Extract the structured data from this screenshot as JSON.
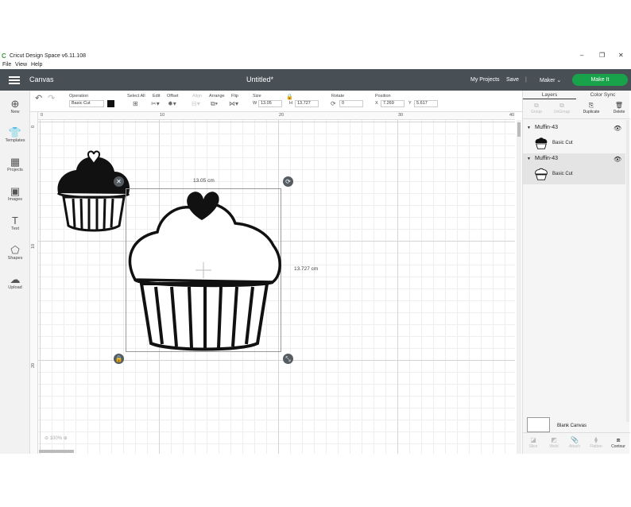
{
  "window": {
    "title": "Cricut Design Space  v6.11.108",
    "controls": [
      "–",
      "❐",
      "✕"
    ]
  },
  "menu": [
    "File",
    "View",
    "Help"
  ],
  "topnav": {
    "canvas_label": "Canvas",
    "doc_title": "Untitled*",
    "my_projects": "My Projects",
    "save": "Save",
    "separator": "|",
    "machine": "Maker",
    "make_it": "Make It"
  },
  "toolbar": {
    "operation_label": "Operation",
    "operation_value": "Basic Cut",
    "select_all_label": "Select All",
    "edit_label": "Edit",
    "offset_label": "Offset",
    "align_label": "Align",
    "arrange_label": "Arrange",
    "flip_label": "Flip",
    "size_label": "Size",
    "w_label": "W",
    "w_value": "13.05",
    "h_label": "H",
    "h_value": "13.727",
    "rotate_label": "Rotate",
    "rotate_value": "0",
    "position_label": "Position",
    "x_label": "X",
    "x_value": "7.269",
    "y_label": "Y",
    "y_value": "5.617"
  },
  "sidebar": [
    {
      "label": "New",
      "icon": "plus-icon"
    },
    {
      "label": "Templates",
      "icon": "shirt-icon"
    },
    {
      "label": "Projects",
      "icon": "projects-icon"
    },
    {
      "label": "Images",
      "icon": "image-icon"
    },
    {
      "label": "Text",
      "icon": "text-icon"
    },
    {
      "label": "Shapes",
      "icon": "shapes-icon"
    },
    {
      "label": "Upload",
      "icon": "upload-icon"
    }
  ],
  "rulers": {
    "top": [
      "0",
      "10",
      "20",
      "30",
      "40"
    ],
    "left": [
      "0",
      "10",
      "20"
    ]
  },
  "canvas": {
    "width_label": "13.05 cm",
    "height_label": "13.727 cm",
    "zoom": "100%"
  },
  "layers_panel": {
    "tabs": [
      "Layers",
      "Color Sync"
    ],
    "actions": [
      "Group",
      "UnGroup",
      "Duplicate",
      "Delete"
    ],
    "groups": [
      {
        "name": "Muffin-43",
        "layer": "Basic Cut"
      },
      {
        "name": "Muffin-43",
        "layer": "Basic Cut"
      }
    ],
    "blank_canvas": "Blank Canvas",
    "bottom_actions": [
      "Slice",
      "Weld",
      "Attach",
      "Flatten",
      "Contour"
    ]
  }
}
